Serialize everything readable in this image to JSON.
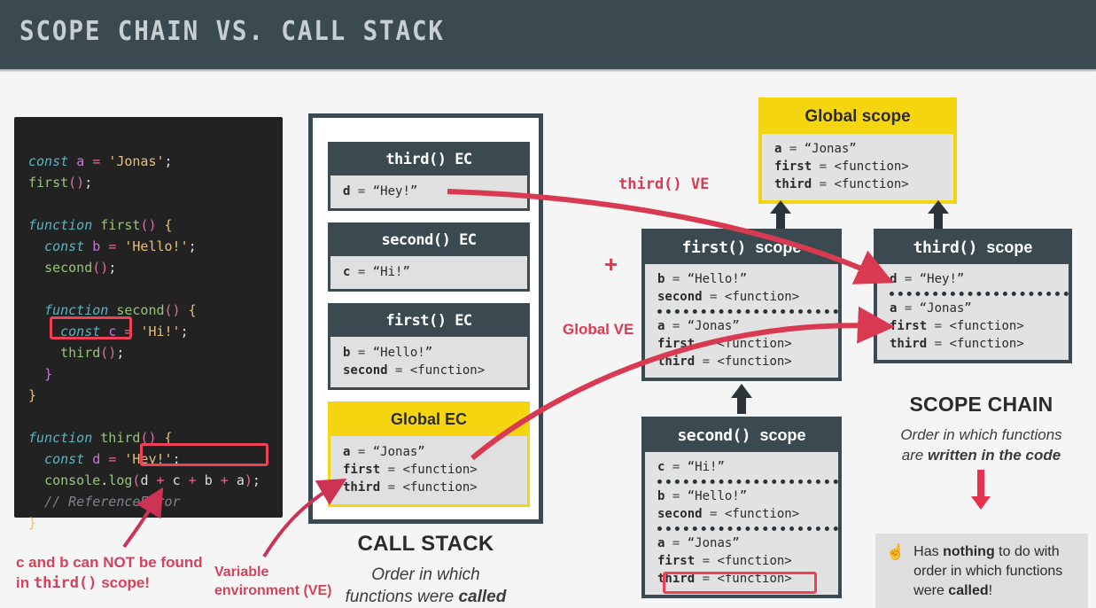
{
  "header": {
    "title": "SCOPE CHAIN VS. CALL STACK"
  },
  "code": {
    "lines": [
      "const a = 'Jonas';",
      "first();",
      "",
      "function first() {",
      "  const b = 'Hello!';",
      "  second();",
      "",
      "  function second() {",
      "    const c = 'Hi!';",
      "    third();",
      "  }",
      "}",
      "",
      "function third() {",
      "  const d = 'Hey!';",
      "  console.log(d + c + b + a);",
      "  // ReferenceError",
      "}"
    ],
    "highlights": [
      "third();",
      "(d + c + b + a)"
    ]
  },
  "call_stack": {
    "frames": [
      {
        "title": "third() EC",
        "style": "dark",
        "entries": [
          {
            "name": "d",
            "value": "“Hey!”"
          }
        ]
      },
      {
        "title": "second() EC",
        "style": "dark",
        "entries": [
          {
            "name": "c",
            "value": "“Hi!”"
          }
        ]
      },
      {
        "title": "first() EC",
        "style": "dark",
        "entries": [
          {
            "name": "b",
            "value": "“Hello!”"
          },
          {
            "name": "second",
            "value": "<function>"
          }
        ]
      },
      {
        "title": "Global EC",
        "style": "yellow",
        "entries": [
          {
            "name": "a",
            "value": "“Jonas”"
          },
          {
            "name": "first",
            "value": "<function>"
          },
          {
            "name": "third",
            "value": "<function>"
          }
        ]
      }
    ],
    "caption_title": "CALL STACK",
    "caption_line1": "Order in which",
    "caption_line2_pre": "functions were ",
    "caption_line2_bold": "called"
  },
  "scopes": {
    "global": {
      "title": "Global scope",
      "entries": [
        {
          "name": "a",
          "value": "“Jonas”"
        },
        {
          "name": "first",
          "value": "<function>"
        },
        {
          "name": "third",
          "value": "<function>"
        }
      ]
    },
    "first": {
      "title_mono": "first()",
      "title_plain": "scope",
      "group1": [
        {
          "name": "b",
          "value": "“Hello!”"
        },
        {
          "name": "second",
          "value": "<function>"
        }
      ],
      "group2": [
        {
          "name": "a",
          "value": "“Jonas”"
        },
        {
          "name": "first",
          "value": "<function>"
        },
        {
          "name": "third",
          "value": "<function>"
        }
      ]
    },
    "third": {
      "title_mono": "third()",
      "title_plain": "scope",
      "group1": [
        {
          "name": "d",
          "value": "“Hey!”"
        }
      ],
      "group2": [
        {
          "name": "a",
          "value": "“Jonas”"
        },
        {
          "name": "first",
          "value": "<function>"
        },
        {
          "name": "third",
          "value": "<function>"
        }
      ]
    },
    "second": {
      "title_mono": "second()",
      "title_plain": "scope",
      "group1": [
        {
          "name": "c",
          "value": "“Hi!”"
        }
      ],
      "group2": [
        {
          "name": "b",
          "value": "“Hello!”"
        },
        {
          "name": "second",
          "value": "<function>"
        }
      ],
      "group3": [
        {
          "name": "a",
          "value": "“Jonas”"
        },
        {
          "name": "first",
          "value": "<function>"
        },
        {
          "name": "third",
          "value": "<function>"
        }
      ]
    }
  },
  "labels": {
    "third_ve": "third() VE",
    "global_ve": "Global VE",
    "plus": "+"
  },
  "scope_chain": {
    "caption_title": "SCOPE CHAIN",
    "caption_line1": "Order in which functions",
    "caption_line2_pre": "are ",
    "caption_line2_bold": "written in the code",
    "note_icon": "☝",
    "note_pre": "Has ",
    "note_bold1": "nothing",
    "note_mid": " to do with order in which functions were ",
    "note_bold2": "called",
    "note_end": "!"
  },
  "annotations": {
    "not_found_line1_pre": "c and b can NOT be found",
    "not_found_line2_pre": "in ",
    "not_found_line2_mono": "third()",
    "not_found_line2_post": " scope!",
    "ve_line1": "Variable",
    "ve_line2": "environment (VE)"
  },
  "colors": {
    "header_bg": "#3a4a50",
    "accent_red": "#d93a52",
    "highlight_red": "#ef4056",
    "yellow": "#f5d510",
    "dark_box": "#3a4a50",
    "body_grey": "#e0e0e0",
    "page_bg": "#f5f5f5"
  }
}
